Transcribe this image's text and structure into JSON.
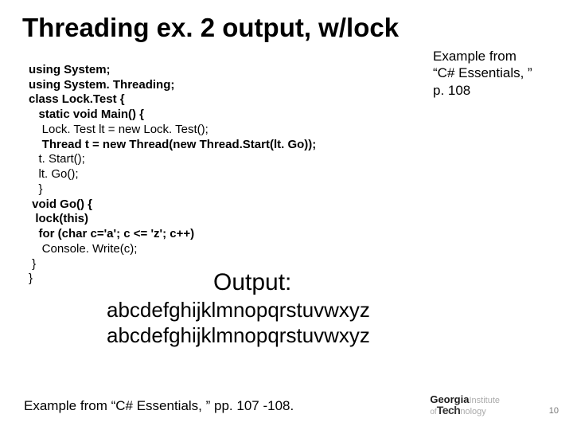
{
  "title": "Threading ex. 2 output, w/lock",
  "side_note": {
    "line1": "Example from",
    "line2": "“C# Essentials, ”",
    "line3": "p. 108"
  },
  "code": {
    "l1": "using System;",
    "l2": "using System. Threading;",
    "l3": "class Lock.Test {",
    "l4": "   static void Main() {",
    "l5": "    Lock. Test lt = new Lock. Test();",
    "l6": "    Thread t = new Thread(new Thread.Start(lt. Go));",
    "l7": "   t. Start();",
    "l8": "   lt. Go();",
    "l9": "   }",
    "l10": " void Go() {",
    "l11": "  lock(this)",
    "l12": "   for (char c='a'; c <= 'z'; c++)",
    "l13": "    Console. Write(c);",
    "l14": " }",
    "l15": "}"
  },
  "output": {
    "label": "Output:",
    "line1": "abcdefghijklmnopqrstuvwxyz",
    "line2": "abcdefghijklmnopqrstuvwxyz"
  },
  "footer_cite": "Example from “C# Essentials, ” pp. 107 -108.",
  "logo": {
    "top1": "Georgia",
    "top2": "Institute",
    "bot1": "Tech",
    "bot2": "nology"
  },
  "page_number": "10"
}
